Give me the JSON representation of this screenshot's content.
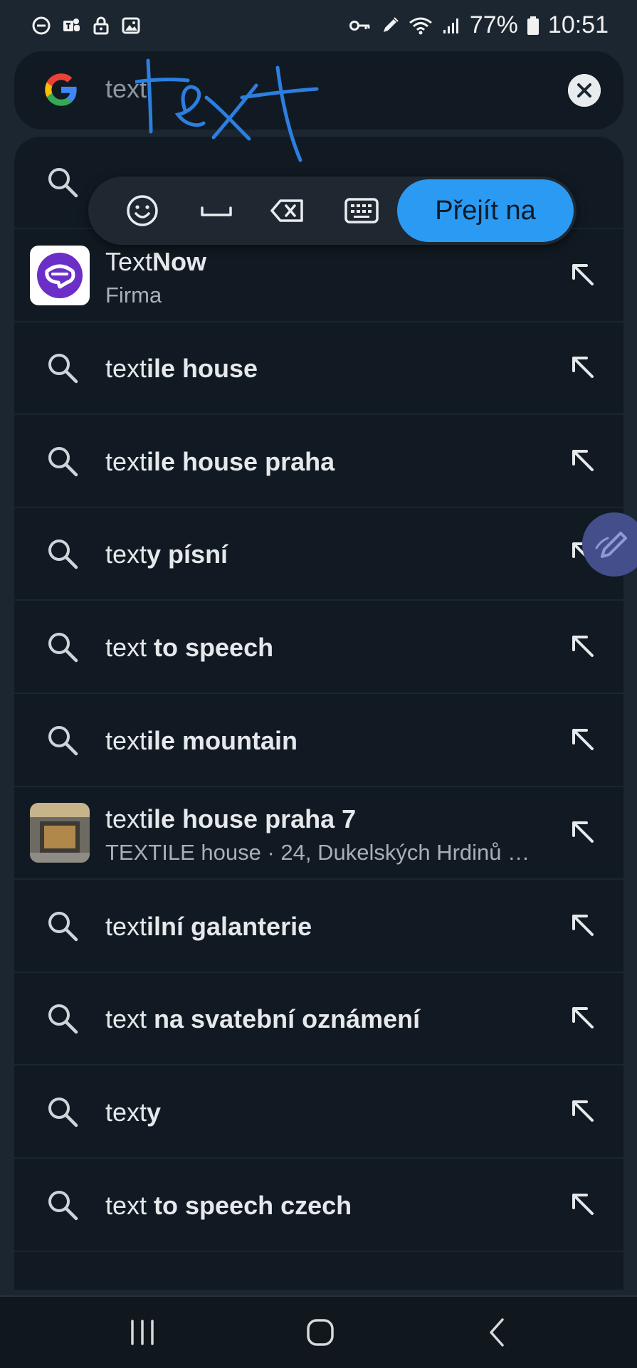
{
  "status_bar": {
    "battery": "77%",
    "time": "10:51"
  },
  "search": {
    "query": "text",
    "handwriting": "text"
  },
  "hw_toolbar": {
    "go_label": "Přejít na"
  },
  "suggestions": [
    {
      "type": "search",
      "prefix": "",
      "bold": "",
      "partial": true
    },
    {
      "type": "app",
      "prefix": "Text",
      "bold": "Now",
      "subtitle": "Firma"
    },
    {
      "type": "search",
      "prefix": "text",
      "bold": "ile house"
    },
    {
      "type": "search",
      "prefix": "text",
      "bold": "ile house praha"
    },
    {
      "type": "search",
      "prefix": "text",
      "bold": "y písní"
    },
    {
      "type": "search",
      "prefix": "text ",
      "bold": "to speech"
    },
    {
      "type": "search",
      "prefix": "text",
      "bold": "ile mountain"
    },
    {
      "type": "place",
      "prefix": "text",
      "bold": "ile house praha 7",
      "subtitle": "TEXTILE house · 24, Dukelských Hrdinů …"
    },
    {
      "type": "search",
      "prefix": "text",
      "bold": "ilní galanterie"
    },
    {
      "type": "search",
      "prefix": "text ",
      "bold": "na svatební oznámení"
    },
    {
      "type": "search",
      "prefix": "text",
      "bold": "y"
    },
    {
      "type": "search",
      "prefix": "text ",
      "bold": "to speech czech"
    }
  ],
  "colors": {
    "accent": "#2a9af2",
    "background": "#1b2631",
    "panel": "#111a22"
  }
}
